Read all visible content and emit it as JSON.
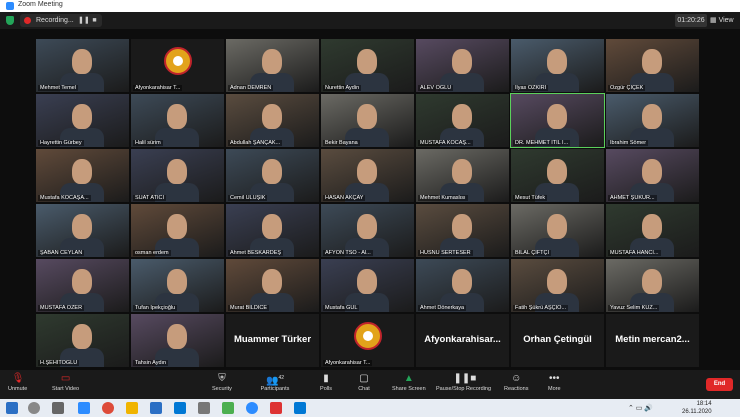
{
  "window": {
    "title": "Zoom Meeting"
  },
  "topbar": {
    "recording_label": "Recording...",
    "pause_icon": "pause-icon",
    "stop_icon": "stop-icon",
    "timer": "01:20:26",
    "view_label": "View"
  },
  "participants": [
    {
      "name": "Mehmet Temel",
      "style": "video"
    },
    {
      "name": "Afyonkarahisar T...",
      "style": "logo"
    },
    {
      "name": "Adnan DEMREN",
      "style": "video"
    },
    {
      "name": "Nurettin Aydin",
      "style": "video"
    },
    {
      "name": "ALEV ÖĞLÜ",
      "style": "video"
    },
    {
      "name": "İlyas ÖZKİRİ",
      "style": "video"
    },
    {
      "name": "Özgür ÇİÇEK",
      "style": "video"
    },
    {
      "name": "Hayrettin Gürbey",
      "style": "video"
    },
    {
      "name": "Halil sürim",
      "style": "video"
    },
    {
      "name": "Abdullah ŞANÇAK...",
      "style": "video"
    },
    {
      "name": "Bekir Bayana",
      "style": "video"
    },
    {
      "name": "MUSTAFA KOCAŞ...",
      "style": "video"
    },
    {
      "name": "DR. MEHMET İTİL İ...",
      "style": "video",
      "active": true
    },
    {
      "name": "İbrahim Sömer",
      "style": "video"
    },
    {
      "name": "Mustafa KOCAŞA...",
      "style": "video"
    },
    {
      "name": "SUAT ATICI",
      "style": "video"
    },
    {
      "name": "Cemil ULUŞIK",
      "style": "video"
    },
    {
      "name": "HASAN AKÇAY",
      "style": "video"
    },
    {
      "name": "Mehmet Kumaslısı",
      "style": "video"
    },
    {
      "name": "Mesut Tüfek",
      "style": "video"
    },
    {
      "name": "AHMET ŞÜKÜR...",
      "style": "video"
    },
    {
      "name": "ŞABAN CEYLAN",
      "style": "video"
    },
    {
      "name": "osman erdem",
      "style": "video"
    },
    {
      "name": "Ahmet BESKARDEŞ",
      "style": "video"
    },
    {
      "name": "AFYON TSO - Al...",
      "style": "video"
    },
    {
      "name": "HÜSNÜ SERTESER",
      "style": "video"
    },
    {
      "name": "BİLAL ÇİFTÇİ",
      "style": "video"
    },
    {
      "name": "MUSTAFA HANCI...",
      "style": "video"
    },
    {
      "name": "MUSTAFA ÖZER",
      "style": "video"
    },
    {
      "name": "Tufan İpekçioğlu",
      "style": "video"
    },
    {
      "name": "Murat BİLDİCE",
      "style": "video"
    },
    {
      "name": "Mustafa GÜL",
      "style": "video"
    },
    {
      "name": "Ahmet Dönerkaya",
      "style": "video"
    },
    {
      "name": "Fatih Şükrü AŞÇIO...",
      "style": "video"
    },
    {
      "name": "Yavuz Selim KUZ...",
      "style": "video"
    },
    {
      "name": "H.ŞEHİTOĞLU",
      "style": "video"
    },
    {
      "name": "Tahsin Aydın",
      "style": "video"
    },
    {
      "name": "Muammer Türker",
      "style": "text"
    },
    {
      "name": "Afyonkarahisar T...",
      "style": "logo"
    },
    {
      "name": "Afyonkarahisar...",
      "style": "text"
    },
    {
      "name": "Orhan Çetingül",
      "style": "text"
    },
    {
      "name": "Metin  mercan2...",
      "style": "text"
    }
  ],
  "toolbar": {
    "unmute": "Unmute",
    "start_video": "Start Video",
    "security": "Security",
    "participants": "Participants",
    "participants_count": "42",
    "polls": "Polls",
    "chat": "Chat",
    "share_screen": "Share Screen",
    "pause_stop_recording": "Pause/Stop Recording",
    "reactions": "Reactions",
    "more": "More",
    "end": "End"
  },
  "taskbar": {
    "time": "18:14",
    "date": "26.11.2020"
  },
  "colors": {
    "accent": "#2d8cff",
    "end": "#e02828",
    "share": "#23a559"
  }
}
